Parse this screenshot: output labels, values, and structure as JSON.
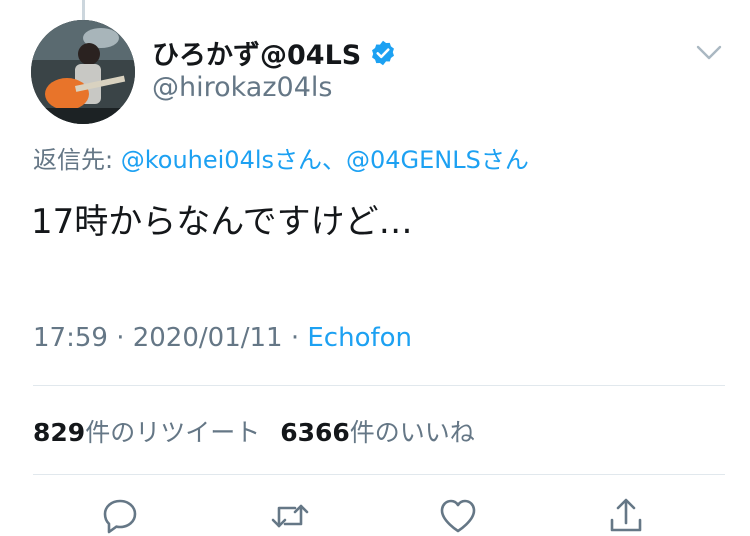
{
  "tweet": {
    "display_name": "ひろかず@04LS",
    "handle": "@hirokaz04ls",
    "verified_icon": "verified-badge-icon",
    "reply_prefix": "返信先: ",
    "reply_mentions": "@kouhei04lsさん、@04GENLSさん",
    "text": "17時からなんですけど…",
    "timestamp": "17:59 · 2020/01/11 · ",
    "source": "Echofon"
  },
  "stats": {
    "retweet_count": "829",
    "retweet_label": "件のリツイート",
    "like_count": "6366",
    "like_label": "件のいいね"
  },
  "actions": [
    "reply-icon",
    "retweet-icon",
    "like-icon",
    "share-icon"
  ],
  "colors": {
    "accent": "#1da1f2",
    "secondary_text": "#657786",
    "divider": "#e1e8ed"
  }
}
